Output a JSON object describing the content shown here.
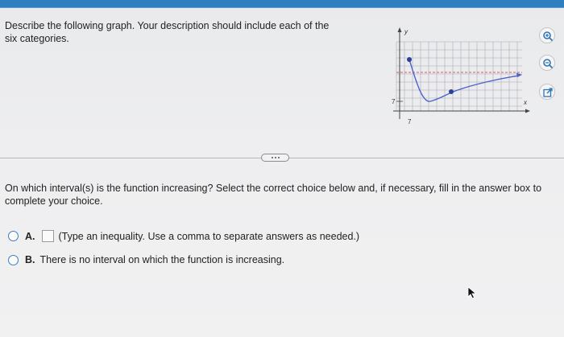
{
  "question": {
    "text": "Describe the following graph. Your description should include each of the six categories."
  },
  "graph": {
    "y_axis_label": "y",
    "x_axis_label": "x",
    "y_tick_label": "7",
    "x_tick_label": "7"
  },
  "tools": {
    "icons": [
      "zoom-in-icon",
      "zoom-out-icon",
      "external-link-icon"
    ]
  },
  "prompt": {
    "text": "On which interval(s) is the function increasing? Select the correct choice below and, if necessary, fill in the answer box to complete your choice."
  },
  "choices": [
    {
      "letter": "A.",
      "text": "(Type an inequality. Use a comma to separate answers as needed.)"
    },
    {
      "letter": "B.",
      "text": "There is no interval on which the function is increasing."
    }
  ],
  "colors": {
    "accent": "#2e7fbf",
    "curve": "#4a63c9",
    "asymptote": "#d85a5a",
    "grid": "#b9bcc4"
  }
}
